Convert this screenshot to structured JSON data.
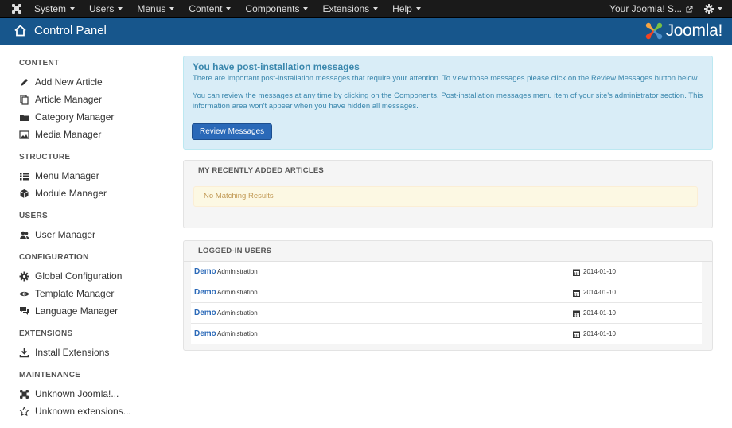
{
  "topnav": {
    "items": [
      {
        "label": "System"
      },
      {
        "label": "Users"
      },
      {
        "label": "Menus"
      },
      {
        "label": "Content"
      },
      {
        "label": "Components"
      },
      {
        "label": "Extensions"
      },
      {
        "label": "Help"
      }
    ],
    "site_link": "Your Joomla! S...",
    "settings_icon": "gear-icon"
  },
  "header": {
    "title": "Control Panel",
    "brand": "Joomla!"
  },
  "sidebar": {
    "sections": [
      {
        "heading": "CONTENT",
        "items": [
          {
            "label": "Add New Article",
            "icon": "pencil-icon"
          },
          {
            "label": "Article Manager",
            "icon": "copy-icon"
          },
          {
            "label": "Category Manager",
            "icon": "folder-icon"
          },
          {
            "label": "Media Manager",
            "icon": "image-icon"
          }
        ]
      },
      {
        "heading": "STRUCTURE",
        "items": [
          {
            "label": "Menu Manager",
            "icon": "list-icon"
          },
          {
            "label": "Module Manager",
            "icon": "cube-icon"
          }
        ]
      },
      {
        "heading": "USERS",
        "items": [
          {
            "label": "User Manager",
            "icon": "users-icon"
          }
        ]
      },
      {
        "heading": "CONFIGURATION",
        "items": [
          {
            "label": "Global Configuration",
            "icon": "cog-icon"
          },
          {
            "label": "Template Manager",
            "icon": "eye-icon"
          },
          {
            "label": "Language Manager",
            "icon": "comments-icon"
          }
        ]
      },
      {
        "heading": "EXTENSIONS",
        "items": [
          {
            "label": "Install Extensions",
            "icon": "download-icon"
          }
        ]
      },
      {
        "heading": "MAINTENANCE",
        "items": [
          {
            "label": "Unknown Joomla!...",
            "icon": "joomla-icon"
          },
          {
            "label": "Unknown extensions...",
            "icon": "star-icon"
          }
        ]
      }
    ]
  },
  "postinstall": {
    "title": "You have post-installation messages",
    "p1": "There are important post-installation messages that require your attention. To view those messages please click on the Review Messages button below.",
    "p2": "You can review the messages at any time by clicking on the Components, Post-installation messages menu item of your site's administrator section. This information area won't appear when you have hidden all messages.",
    "button": "Review Messages"
  },
  "recent_articles": {
    "heading": "MY RECENTLY ADDED ARTICLES",
    "empty": "No Matching Results"
  },
  "logged_in": {
    "heading": "LOGGED-IN USERS",
    "rows": [
      {
        "name": "Demo",
        "role": "Administration",
        "date": "2014-01-10"
      },
      {
        "name": "Demo",
        "role": "Administration",
        "date": "2014-01-10"
      },
      {
        "name": "Demo",
        "role": "Administration",
        "date": "2014-01-10"
      },
      {
        "name": "Demo",
        "role": "Administration",
        "date": "2014-01-10"
      }
    ]
  },
  "colors": {
    "navbar": "#1a1a1a",
    "header": "#17568c",
    "link": "#2a69b8",
    "alert_bg": "#d9edf7"
  }
}
